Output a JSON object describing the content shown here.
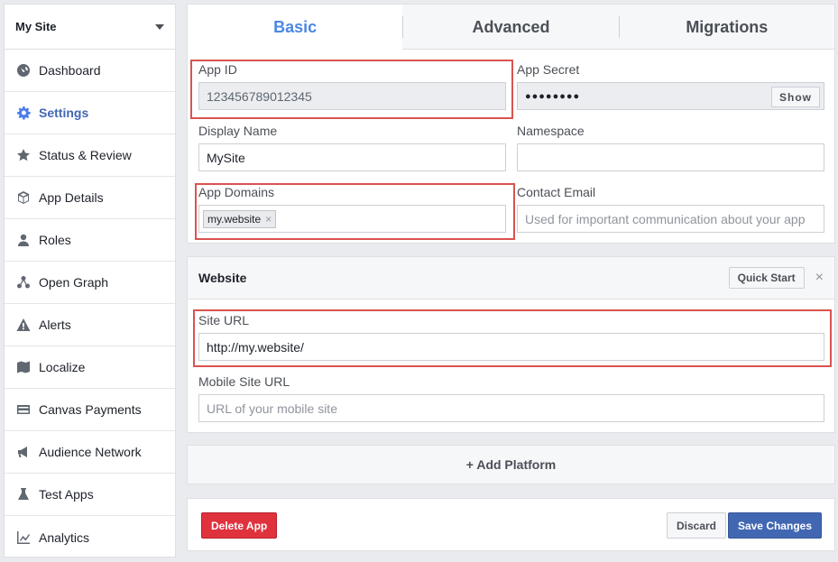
{
  "sidebar": {
    "site_name": "My Site",
    "items": [
      {
        "label": "Dashboard",
        "icon": "dashboard-icon"
      },
      {
        "label": "Settings",
        "icon": "gear-icon",
        "active": true
      },
      {
        "label": "Status & Review",
        "icon": "star-icon"
      },
      {
        "label": "App Details",
        "icon": "cube-icon"
      },
      {
        "label": "Roles",
        "icon": "person-icon"
      },
      {
        "label": "Open Graph",
        "icon": "graph-icon"
      },
      {
        "label": "Alerts",
        "icon": "warning-icon"
      },
      {
        "label": "Localize",
        "icon": "map-icon"
      },
      {
        "label": "Canvas Payments",
        "icon": "card-icon"
      },
      {
        "label": "Audience Network",
        "icon": "megaphone-icon"
      },
      {
        "label": "Test Apps",
        "icon": "flask-icon"
      },
      {
        "label": "Analytics",
        "icon": "chart-icon"
      }
    ]
  },
  "tabs": [
    {
      "label": "Basic",
      "active": true
    },
    {
      "label": "Advanced"
    },
    {
      "label": "Migrations"
    }
  ],
  "basic": {
    "app_id_label": "App ID",
    "app_id_value": "123456789012345",
    "app_secret_label": "App Secret",
    "app_secret_value": "●●●●●●●●",
    "show_label": "Show",
    "display_name_label": "Display Name",
    "display_name_value": "MySite",
    "namespace_label": "Namespace",
    "namespace_value": "",
    "app_domains_label": "App Domains",
    "app_domain_tag": "my.website",
    "contact_email_label": "Contact Email",
    "contact_email_placeholder": "Used for important communication about your app"
  },
  "website": {
    "title": "Website",
    "quick_start_label": "Quick Start",
    "close_symbol": "×",
    "site_url_label": "Site URL",
    "site_url_value": "http://my.website/",
    "mobile_url_label": "Mobile Site URL",
    "mobile_url_placeholder": "URL of your mobile site"
  },
  "add_platform_label": "+ Add Platform",
  "footer": {
    "delete_label": "Delete App",
    "discard_label": "Discard",
    "save_label": "Save Changes"
  },
  "colors": {
    "accent": "#4267b2",
    "tab_active": "#4b88e4",
    "delete": "#e0323d",
    "highlight_box": "#d9534f"
  }
}
